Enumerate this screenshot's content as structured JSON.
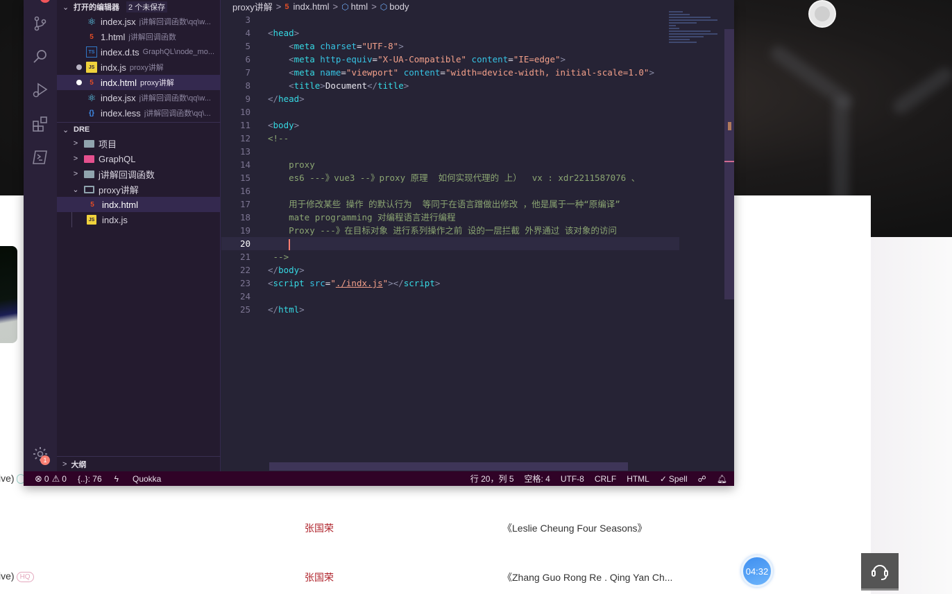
{
  "background_page": {
    "rows": [
      {
        "prefix": "ive)",
        "artist": "张国荣",
        "album": "《Leslie Cheung Four Seasons》"
      },
      {
        "prefix": "ive)",
        "badge": "HQ",
        "artist": "张国荣",
        "album": "《Zhang Guo Rong Re . Qing Yan Ch..."
      }
    ],
    "timer": "04:32",
    "support_icon": "headset-icon"
  },
  "vscode": {
    "activity_bar": [
      {
        "name": "explorer",
        "icon": "files-icon"
      },
      {
        "name": "source-control",
        "icon": "source-control-icon"
      },
      {
        "name": "search",
        "icon": "search-icon"
      },
      {
        "name": "run-debug",
        "icon": "run-debug-icon"
      },
      {
        "name": "extensions",
        "icon": "extensions-icon"
      },
      {
        "name": "terminal",
        "icon": "terminal-icon"
      },
      {
        "name": "settings",
        "icon": "gear-icon",
        "badge": "1"
      }
    ],
    "open_editors": {
      "title": "打开的编辑器",
      "unsaved": "2 个未保存",
      "items": [
        {
          "name": "index.jsx",
          "desc": "j讲解回调函数\\qq\\w...",
          "icon": "react-icon",
          "dirty": false
        },
        {
          "name": "1.html",
          "desc": "j讲解回调函数",
          "icon": "html5-icon",
          "dirty": false
        },
        {
          "name": "index.d.ts",
          "desc": "GraphQL\\node_mo...",
          "icon": "ts-icon",
          "dirty": false
        },
        {
          "name": "indx.js",
          "desc": "proxy讲解",
          "icon": "js-icon",
          "dirty": true
        },
        {
          "name": "indx.html",
          "desc": "proxy讲解",
          "icon": "html5-icon",
          "dirty": true,
          "active": true
        },
        {
          "name": "index.jsx",
          "desc": "j讲解回调函数\\qq\\w...",
          "icon": "react-icon",
          "dirty": false
        },
        {
          "name": "index.less",
          "desc": "j讲解回调函数\\qq\\...",
          "icon": "less-icon",
          "dirty": false
        }
      ]
    },
    "explorer": {
      "title": "DRE",
      "tree": [
        {
          "label": "项目",
          "type": "folder",
          "expanded": false
        },
        {
          "label": "GraphQL",
          "type": "folder",
          "expanded": false
        },
        {
          "label": "j讲解回调函数",
          "type": "folder",
          "expanded": false
        },
        {
          "label": "proxy讲解",
          "type": "folder",
          "expanded": true
        },
        {
          "label": "indx.html",
          "type": "file",
          "icon": "html5-icon",
          "active": true
        },
        {
          "label": "indx.js",
          "type": "file",
          "icon": "js-icon"
        }
      ]
    },
    "outline_title": "大纲",
    "breadcrumb": [
      "proxy讲解",
      "indx.html",
      "html",
      "body"
    ],
    "code_lines": [
      {
        "n": "3",
        "tokens": []
      },
      {
        "n": "4",
        "tokens": [
          [
            "br",
            "<"
          ],
          [
            "tag",
            "head"
          ],
          [
            "br",
            ">"
          ]
        ]
      },
      {
        "n": "5",
        "tokens": [
          [
            "sp",
            "    "
          ],
          [
            "br",
            "<"
          ],
          [
            "tag",
            "meta "
          ],
          [
            "attr",
            "charset"
          ],
          [
            "txt",
            "="
          ],
          [
            "str",
            "\"UTF-8\""
          ],
          [
            "br",
            ">"
          ]
        ]
      },
      {
        "n": "6",
        "tokens": [
          [
            "sp",
            "    "
          ],
          [
            "br",
            "<"
          ],
          [
            "tag",
            "meta "
          ],
          [
            "attr",
            "http-equiv"
          ],
          [
            "txt",
            "="
          ],
          [
            "str",
            "\"X-UA-Compatible\" "
          ],
          [
            "attr",
            "content"
          ],
          [
            "txt",
            "="
          ],
          [
            "str",
            "\"IE=edge\""
          ],
          [
            "br",
            ">"
          ]
        ]
      },
      {
        "n": "7",
        "tokens": [
          [
            "sp",
            "    "
          ],
          [
            "br",
            "<"
          ],
          [
            "tag",
            "meta "
          ],
          [
            "attr",
            "name"
          ],
          [
            "txt",
            "="
          ],
          [
            "str",
            "\"viewport\" "
          ],
          [
            "attr",
            "content"
          ],
          [
            "txt",
            "="
          ],
          [
            "str",
            "\"width=device-width, initial-scale=1.0\""
          ],
          [
            "br",
            ">"
          ]
        ]
      },
      {
        "n": "8",
        "tokens": [
          [
            "sp",
            "    "
          ],
          [
            "br",
            "<"
          ],
          [
            "tag",
            "title"
          ],
          [
            "br",
            ">"
          ],
          [
            "txt",
            "Document"
          ],
          [
            "br",
            "</"
          ],
          [
            "tag",
            "title"
          ],
          [
            "br",
            ">"
          ]
        ]
      },
      {
        "n": "9",
        "tokens": [
          [
            "br",
            "</"
          ],
          [
            "tag",
            "head"
          ],
          [
            "br",
            ">"
          ]
        ]
      },
      {
        "n": "10",
        "tokens": []
      },
      {
        "n": "11",
        "tokens": [
          [
            "br",
            "<"
          ],
          [
            "tag",
            "body"
          ],
          [
            "br",
            ">"
          ]
        ]
      },
      {
        "n": "12",
        "tokens": [
          [
            "cm",
            "<!--"
          ]
        ]
      },
      {
        "n": "13",
        "tokens": []
      },
      {
        "n": "14",
        "tokens": [
          [
            "cm",
            "    proxy"
          ]
        ]
      },
      {
        "n": "15",
        "tokens": [
          [
            "cm",
            "    es6 ---》vue3 --》proxy 原理  如何实现代理的 上）  vx : xdr2211587076 、"
          ]
        ]
      },
      {
        "n": "16",
        "tokens": []
      },
      {
        "n": "17",
        "tokens": [
          [
            "cm",
            "    用于修改某些 操作 的默认行为  等同于在语言蹭做出修改 ，他是属于一种“原编译”"
          ]
        ]
      },
      {
        "n": "18",
        "tokens": [
          [
            "cm",
            "    mate programming 对编程语言进行编程"
          ]
        ]
      },
      {
        "n": "19",
        "tokens": [
          [
            "cm",
            "    Proxy ---》在目标对象 进行系列操作之前 设的一层拦截 外界通过 该对象的访问"
          ]
        ]
      },
      {
        "n": "20",
        "tokens": [
          [
            "sp",
            "    "
          ],
          [
            "cursor",
            ""
          ]
        ],
        "current": true
      },
      {
        "n": "21",
        "tokens": [
          [
            "cm",
            " -->"
          ]
        ]
      },
      {
        "n": "22",
        "tokens": [
          [
            "br",
            "</"
          ],
          [
            "tag",
            "body"
          ],
          [
            "br",
            ">"
          ]
        ]
      },
      {
        "n": "23",
        "tokens": [
          [
            "br",
            "<"
          ],
          [
            "tag",
            "script "
          ],
          [
            "attr",
            "src"
          ],
          [
            "txt",
            "="
          ],
          [
            "str",
            "\""
          ],
          [
            "link",
            "./indx.js"
          ],
          [
            "str",
            "\""
          ],
          [
            "br",
            "></"
          ],
          [
            "tag",
            "script"
          ],
          [
            "br",
            ">"
          ]
        ]
      },
      {
        "n": "24",
        "tokens": []
      },
      {
        "n": "25",
        "tokens": [
          [
            "br",
            "</"
          ],
          [
            "tag",
            "html"
          ],
          [
            "br",
            ">"
          ]
        ]
      }
    ],
    "status_bar": {
      "errors": "0",
      "warnings": "0",
      "braces": "{..}: 76",
      "quokka": "Quokka",
      "position": "行 20，列 5",
      "spaces": "空格: 4",
      "encoding": "UTF-8",
      "eol": "CRLF",
      "language": "HTML",
      "spell": "Spell"
    }
  }
}
